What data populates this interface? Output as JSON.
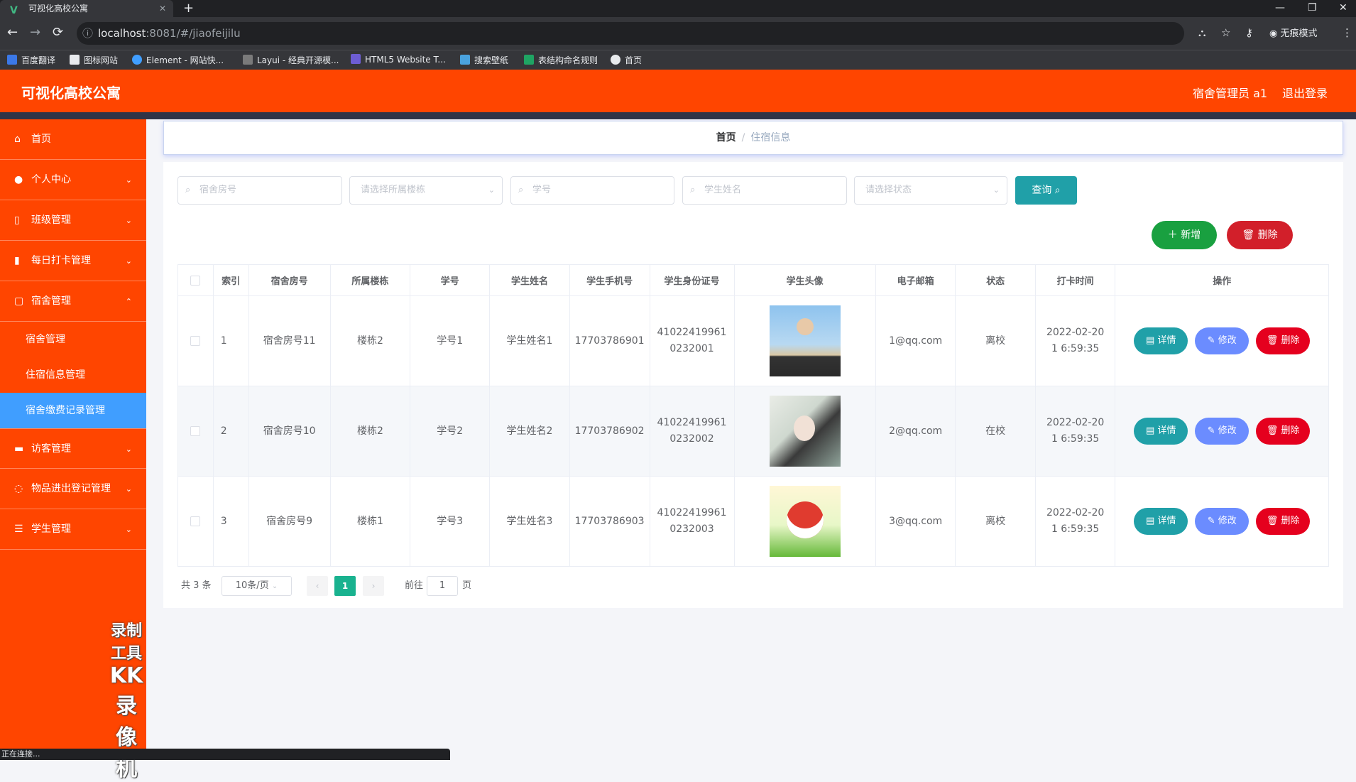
{
  "browser": {
    "tab_title": "可视化高校公寓",
    "url_host": "localhost",
    "url_path": ":8081/#/jiaofeijilu",
    "incognito_label": "无痕模式",
    "bookmarks": [
      "百度翻译",
      "图标网站",
      "Element - 网站快...",
      "Layui - 经典开源模...",
      "HTML5 Website T...",
      "搜索壁纸",
      "表结构命名规则",
      "首页"
    ],
    "status_text": "正在连接..."
  },
  "header": {
    "brand": "可视化高校公寓",
    "user_label": "宿舍管理员 a1",
    "logout_label": "退出登录",
    "color": "#ff4500"
  },
  "sidebar": {
    "items": [
      {
        "label": "首页",
        "icon": "home-icon"
      },
      {
        "label": "个人中心",
        "icon": "user-icon"
      },
      {
        "label": "班级管理",
        "icon": "class-icon"
      },
      {
        "label": "每日打卡管理",
        "icon": "chart-icon"
      },
      {
        "label": "宿舍管理",
        "icon": "dorm-icon"
      },
      {
        "label": "访客管理",
        "icon": "visitor-icon"
      },
      {
        "label": "物品进出登记管理",
        "icon": "item-icon"
      },
      {
        "label": "学生管理",
        "icon": "student-icon"
      }
    ],
    "sub_items": [
      "宿舍管理",
      "住宿信息管理",
      "宿舍缴费记录管理"
    ],
    "active_sub": "宿舍缴费记录管理",
    "watermark_line1": "录制工具",
    "watermark_line2": "KK录像机"
  },
  "breadcrumb": {
    "home": "首页",
    "current": "住宿信息"
  },
  "search": {
    "room_placeholder": "宿舍房号",
    "building_placeholder": "请选择所属楼栋",
    "student_no_placeholder": "学号",
    "student_name_placeholder": "学生姓名",
    "status_placeholder": "请选择状态",
    "query_label": "查询"
  },
  "actions": {
    "add_label": "新增",
    "delete_label": "删除"
  },
  "table": {
    "headers": [
      "索引",
      "宿舍房号",
      "所属楼栋",
      "学号",
      "学生姓名",
      "学生手机号",
      "学生身份证号",
      "学生头像",
      "电子邮箱",
      "状态",
      "打卡时间",
      "操作"
    ],
    "rows": [
      {
        "index": "1",
        "room": "宿舍房号11",
        "building": "楼栋2",
        "student_no": "学号1",
        "name": "学生姓名1",
        "phone": "17703786901",
        "id_card": "41022419961 0232001",
        "email": "1@qq.com",
        "status": "离校",
        "time": "2022-02-20 1 6:59:35"
      },
      {
        "index": "2",
        "room": "宿舍房号10",
        "building": "楼栋2",
        "student_no": "学号2",
        "name": "学生姓名2",
        "phone": "17703786902",
        "id_card": "41022419961 0232002",
        "email": "2@qq.com",
        "status": "在校",
        "time": "2022-02-20 1 6:59:35"
      },
      {
        "index": "3",
        "room": "宿舍房号9",
        "building": "楼栋1",
        "student_no": "学号3",
        "name": "学生姓名3",
        "phone": "17703786903",
        "id_card": "41022419961 0232003",
        "email": "3@qq.com",
        "status": "离校",
        "time": "2022-02-20 1 6:59:35"
      }
    ],
    "op_detail": "详情",
    "op_edit": "修改",
    "op_delete": "删除"
  },
  "pagination": {
    "total_label": "共 3 条",
    "page_size": "10条/页",
    "current_page": "1",
    "goto_label": "前往",
    "goto_value": "1",
    "page_suffix": "页"
  }
}
